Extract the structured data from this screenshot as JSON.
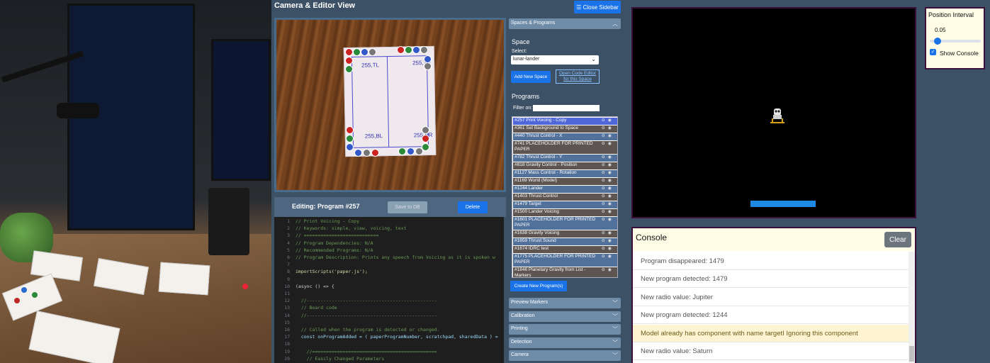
{
  "header": {
    "title": "Camera & Editor View",
    "close_sidebar": "☰ Close Sidebar"
  },
  "camera": {
    "coords": [
      "255,TL",
      "255,TR",
      "255,BL",
      "255,BR"
    ]
  },
  "editor": {
    "title": "Editing: Program #257",
    "save_label": "Save to DB",
    "delete_label": "Delete",
    "code_lines": [
      {
        "n": "1",
        "t": "// Print Voicing - Copy",
        "c": "#6a9955"
      },
      {
        "n": "2",
        "t": "// Keywords: simple, view, voicing, text",
        "c": "#6a9955"
      },
      {
        "n": "3",
        "t": "// ===========================",
        "c": "#6a9955"
      },
      {
        "n": "4",
        "t": "// Program Dependencies: N/A",
        "c": "#6a9955"
      },
      {
        "n": "5",
        "t": "// Recommended Programs: N/A",
        "c": "#6a9955"
      },
      {
        "n": "6",
        "t": "// Program Description: Prints any speech from Voicing as it is spoken w",
        "c": "#6a9955"
      },
      {
        "n": "7",
        "t": "",
        "c": "#d4d4d4"
      },
      {
        "n": "8",
        "t": "importScripts('paper.js');",
        "c": "#dcdcaa"
      },
      {
        "n": "9",
        "t": "",
        "c": "#d4d4d4"
      },
      {
        "n": "10",
        "t": "(async () => {",
        "c": "#d4d4d4"
      },
      {
        "n": "11",
        "t": "",
        "c": "#d4d4d4"
      },
      {
        "n": "12",
        "t": "  //-----------------------------------------------",
        "c": "#6a9955"
      },
      {
        "n": "13",
        "t": "  // Board code",
        "c": "#6a9955"
      },
      {
        "n": "14",
        "t": "  //-----------------------------------------------",
        "c": "#6a9955"
      },
      {
        "n": "15",
        "t": "",
        "c": "#d4d4d4"
      },
      {
        "n": "16",
        "t": "  // Called when the program is detected or changed.",
        "c": "#6a9955"
      },
      {
        "n": "17",
        "t": "  const onProgramAdded = ( paperProgramNumber, scratchpad, sharedData ) =",
        "c": "#9cdcfe"
      },
      {
        "n": "18",
        "t": "",
        "c": "#d4d4d4"
      },
      {
        "n": "19",
        "t": "    //=============================================",
        "c": "#6a9955"
      },
      {
        "n": "20",
        "t": "    // Easily Changed Parameters",
        "c": "#6a9955"
      }
    ]
  },
  "sidebar": {
    "spaces_header": "Spaces & Programs",
    "space_title": "Space",
    "select_label": "Select:",
    "selected_space": "lunar-lander",
    "add_space": "Add New Space",
    "open_editor": "Open Code Editor for this Space",
    "programs_title": "Programs",
    "filter_label": "Filter on:",
    "programs": [
      {
        "label": "#257 Print Voicing - Copy",
        "lines": 1,
        "selected": true
      },
      {
        "label": "#361 Set Background to Space",
        "lines": 1
      },
      {
        "label": "#440 Thrust Control - X",
        "lines": 1
      },
      {
        "label": "#741 PLACEHOLDER FOR PRINTED PAPER",
        "lines": 2
      },
      {
        "label": "#782 Thrust Control - Y",
        "lines": 1
      },
      {
        "label": "#818 Gravity Control - Position",
        "lines": 1
      },
      {
        "label": "#1127 Mass Control - Rotation",
        "lines": 1
      },
      {
        "label": "#1169 World (Model)",
        "lines": 1
      },
      {
        "label": "#1244 Lander",
        "lines": 1
      },
      {
        "label": "#1403 Thrust Control",
        "lines": 1
      },
      {
        "label": "#1479 Target",
        "lines": 1
      },
      {
        "label": "#1500 Lander Voicing",
        "lines": 1
      },
      {
        "label": "#1601 PLACEHOLDER FOR PRINTED PAPER",
        "lines": 2
      },
      {
        "label": "#1638 Gravity Voicing",
        "lines": 1
      },
      {
        "label": "#1659 Thrust Sound",
        "lines": 1
      },
      {
        "label": "#1674 IDRC test",
        "lines": 1
      },
      {
        "label": "#1775 PLACEHOLDER FOR PRINTED PAPER",
        "lines": 2
      },
      {
        "label": "#1846 Planetary Gravity from List - Markers",
        "lines": 2
      }
    ],
    "create_program": "Create New Program(s)",
    "sections": [
      "Preview Markers",
      "Calibration",
      "Printing",
      "Detection",
      "Camera"
    ]
  },
  "settings": {
    "title": "Position Interval",
    "value": "0.05",
    "slider_fraction": 0.1,
    "show_console_label": "Show Console",
    "show_console_checked": true
  },
  "console": {
    "title": "Console",
    "clear_label": "Clear",
    "entries": [
      {
        "text": "Program disappeared: 1479",
        "level": "info"
      },
      {
        "text": "New program detected: 1479",
        "level": "info"
      },
      {
        "text": "New radio value: Jupiter",
        "level": "info"
      },
      {
        "text": "New program detected: 1244",
        "level": "info"
      },
      {
        "text": "Model already has component with name targetI Ignoring this component",
        "level": "warn"
      },
      {
        "text": "New radio value: Saturn",
        "level": "info"
      }
    ]
  },
  "colors": {
    "accent": "#1a73e8",
    "page_bg": "#3d5166",
    "selected_row": "#4f67d8",
    "row_a": "#5e5550",
    "row_b": "#52719a"
  }
}
